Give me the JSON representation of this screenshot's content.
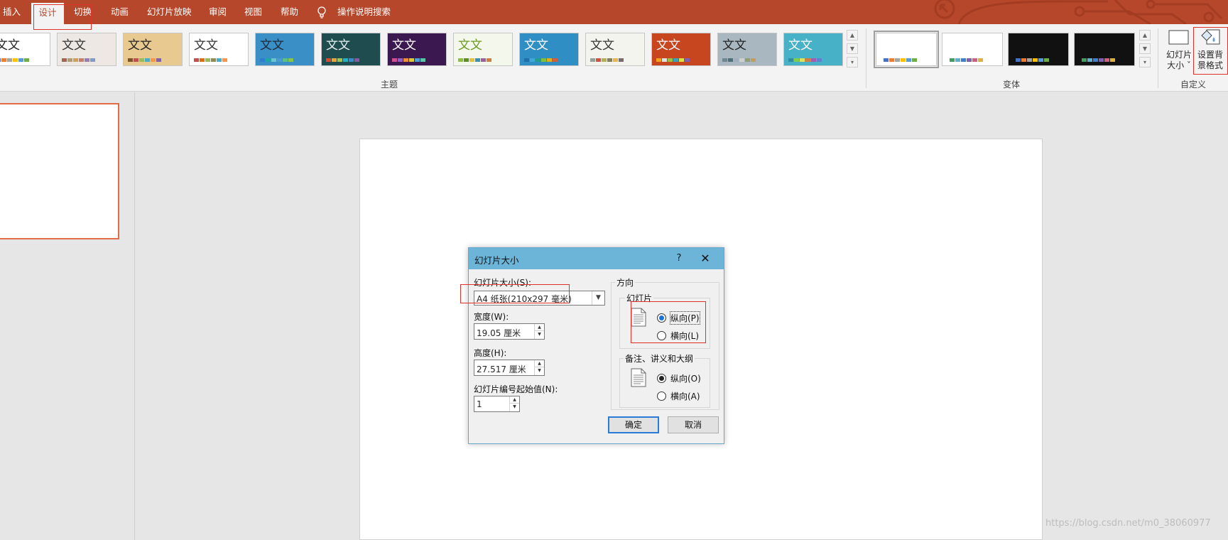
{
  "tabs": [
    {
      "label": "插入",
      "active": false
    },
    {
      "label": "设计",
      "active": true
    },
    {
      "label": "切换",
      "active": false
    },
    {
      "label": "动画",
      "active": false
    },
    {
      "label": "幻灯片放映",
      "active": false
    },
    {
      "label": "审阅",
      "active": false
    },
    {
      "label": "视图",
      "active": false
    },
    {
      "label": "帮助",
      "active": false
    }
  ],
  "tell_me": {
    "label": "操作说明搜索",
    "icon": "lightbulb-icon"
  },
  "ribbon": {
    "themes_group_label": "主题",
    "variants_group_label": "变体",
    "customize_group_label": "自定义",
    "theme_sample_text": "文文",
    "slide_size_button": {
      "line1": "幻灯片",
      "line2": "大小 ˇ"
    },
    "format_background_button": {
      "line1": "设置背",
      "line2": "景格式"
    },
    "themes": [
      {
        "bg": "#ffffff",
        "fg": "#222222",
        "swatches": [
          "#4472c4",
          "#ed7d31",
          "#a5a5a5",
          "#ffc000",
          "#5b9bd5",
          "#70ad47"
        ]
      },
      {
        "bg": "#ede8e3",
        "fg": "#333333",
        "swatches": [
          "#a5644e",
          "#b39b73",
          "#d0a05a",
          "#c97d6b",
          "#9a7db4",
          "#7e9bc9"
        ]
      },
      {
        "bg": "#e8c98f",
        "fg": "#222222",
        "swatches": [
          "#7e5327",
          "#c0504d",
          "#9bbb59",
          "#4bacc6",
          "#f79646",
          "#8064a2"
        ]
      },
      {
        "bg": "#ffffff",
        "fg": "#333333",
        "swatches": [
          "#c0504d",
          "#e46c0a",
          "#9bbb59",
          "#948a54",
          "#4bacc6",
          "#f79646"
        ]
      },
      {
        "bg": "#3b8fc7",
        "fg": "#1b2a3a",
        "swatches": [
          "#2d7dd2",
          "#1aa8a4",
          "#6bc3d1",
          "#4a9bd1",
          "#5abf8a",
          "#89c44a"
        ]
      },
      {
        "bg": "#1f4c4f",
        "fg": "#e9f2f2",
        "swatches": [
          "#d84a28",
          "#f0a22e",
          "#a5c249",
          "#1eb3c4",
          "#3a89c9",
          "#8a58a3"
        ]
      },
      {
        "bg": "#3b1850",
        "fg": "#ffffff",
        "swatches": [
          "#d34e8f",
          "#8d5fc7",
          "#ef8f2f",
          "#e0c43b",
          "#4a9ed9",
          "#59c3a5"
        ]
      },
      {
        "bg": "#f3f7ec",
        "fg": "#6a9a1f",
        "swatches": [
          "#8fbf3f",
          "#5f8f1f",
          "#dfc03f",
          "#3f8faf",
          "#9f5f9f",
          "#cf7f3f"
        ]
      },
      {
        "bg": "#2f8fc4",
        "fg": "#ffffff",
        "swatches": [
          "#1f6fa8",
          "#3fa6d8",
          "#1f9f8f",
          "#7fbf3f",
          "#dfaf1f",
          "#cf5f3f"
        ]
      },
      {
        "bg": "#f4f4ee",
        "fg": "#333333",
        "swatches": [
          "#93a299",
          "#cf543f",
          "#b5ae53",
          "#848058",
          "#e8b54d",
          "#786c71"
        ]
      },
      {
        "bg": "#c7451f",
        "fg": "#ffffff",
        "swatches": [
          "#f6a21d",
          "#e0e0e0",
          "#9fbf3f",
          "#3f9fbf",
          "#dfdf3f",
          "#7f5faf"
        ]
      },
      {
        "bg": "#a9b8c0",
        "fg": "#222222",
        "swatches": [
          "#6f8790",
          "#4f6f7f",
          "#9fafbf",
          "#cfcfcf",
          "#8f9f6f",
          "#bf9f5f"
        ]
      },
      {
        "bg": "#47b2c7",
        "fg": "#ffffff",
        "swatches": [
          "#2f8f9f",
          "#7fcf4f",
          "#dfdf5f",
          "#cf7f3f",
          "#9f5faf",
          "#5f7fcf"
        ]
      }
    ],
    "variants": [
      {
        "bg": "#ffffff",
        "selected": true,
        "swatches": [
          "#4472c4",
          "#ed7d31",
          "#a5a5a5",
          "#ffc000",
          "#5b9bd5",
          "#70ad47"
        ]
      },
      {
        "bg": "#ffffff",
        "selected": false,
        "swatches": [
          "#3f9f5f",
          "#5fafcf",
          "#3f7fcf",
          "#7f5faf",
          "#cf5f7f",
          "#dfaf3f"
        ]
      },
      {
        "bg": "#111111",
        "selected": false,
        "swatches": [
          "#4472c4",
          "#ed7d31",
          "#a5a5a5",
          "#ffc000",
          "#5b9bd5",
          "#70ad47"
        ]
      },
      {
        "bg": "#111111",
        "selected": false,
        "swatches": [
          "#3f9f5f",
          "#5fafcf",
          "#3f7fcf",
          "#7f5faf",
          "#cf5f7f",
          "#dfaf3f"
        ]
      }
    ]
  },
  "dialog": {
    "title": "幻灯片大小",
    "help": "?",
    "close": "✕",
    "slide_size_label": "幻灯片大小(S):",
    "slide_size_value": "A4 纸张(210x297 毫米)",
    "width_label": "宽度(W):",
    "width_value": "19.05 厘米",
    "height_label": "高度(H):",
    "height_value": "27.517 厘米",
    "start_number_label": "幻灯片编号起始值(N):",
    "start_number_value": "1",
    "orientation_label": "方向",
    "slides_group_label": "幻灯片",
    "slides_portrait": "纵向(P)",
    "slides_landscape": "横向(L)",
    "slides_portrait_selected": true,
    "notes_group_label": "备注、讲义和大纲",
    "notes_portrait": "纵向(O)",
    "notes_landscape": "横向(A)",
    "notes_portrait_selected": true,
    "ok": "确定",
    "cancel": "取消"
  },
  "watermark": "https://blog.csdn.net/m0_38060977",
  "colors": {
    "accent": "#b7472a",
    "dialog_title": "#6cb5d9",
    "annotation": "#e0302a",
    "slide_selected": "#e36b47"
  }
}
